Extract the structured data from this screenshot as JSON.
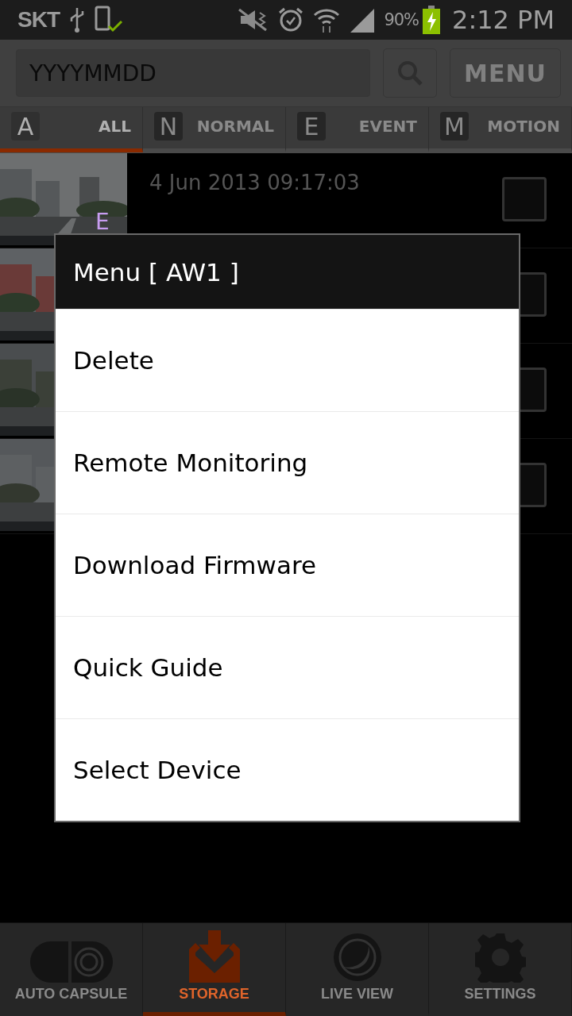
{
  "status_bar": {
    "carrier": "SKT",
    "battery_percent": "90%",
    "time": "2:12 PM"
  },
  "toolbar": {
    "search": {
      "placeholder": "YYYYMMDD"
    },
    "menu_button": "MENU"
  },
  "filter_tabs": [
    {
      "letter": "A",
      "label": "ALL",
      "selected": true
    },
    {
      "letter": "N",
      "label": "NORMAL",
      "selected": false
    },
    {
      "letter": "E",
      "label": "EVENT",
      "selected": false
    },
    {
      "letter": "M",
      "label": "MOTION",
      "selected": false
    }
  ],
  "recordings": [
    {
      "date": "4 Jun 2013 09:17:03",
      "badge": "E",
      "checked": false
    },
    {
      "checked": false
    },
    {
      "checked": false
    },
    {
      "checked": false
    }
  ],
  "dialog": {
    "title": "Menu [ AW1 ]",
    "items": [
      "Delete",
      "Remote Monitoring",
      "Download Firmware",
      "Quick Guide",
      "Select Device"
    ]
  },
  "bottom_nav": [
    {
      "kind": "capsule",
      "label": "AUTO CAPSULE",
      "selected": false
    },
    {
      "kind": "storage",
      "label": "STORAGE",
      "selected": true
    },
    {
      "kind": "liveview",
      "label": "LIVE VIEW",
      "selected": false
    },
    {
      "kind": "settings",
      "label": "SETTINGS",
      "selected": false
    }
  ]
}
